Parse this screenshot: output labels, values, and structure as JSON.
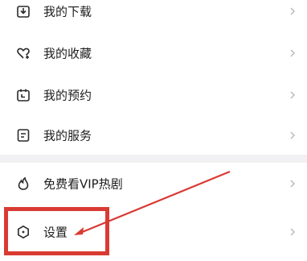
{
  "menu": {
    "items": [
      {
        "label": "我的下载",
        "icon": "download-icon"
      },
      {
        "label": "我的收藏",
        "icon": "favorite-heart-icon"
      },
      {
        "label": "我的预约",
        "icon": "calendar-icon"
      },
      {
        "label": "我的服务",
        "icon": "service-document-icon"
      },
      {
        "label": "免费看VIP热剧",
        "icon": "flame-icon"
      },
      {
        "label": "设置",
        "icon": "settings-icon"
      }
    ]
  },
  "annotation": {
    "highlight_color": "#d93a33",
    "highlight_target": "设置"
  },
  "colors": {
    "background": "#f1f1f3",
    "card": "#ffffff",
    "text": "#1d1d1f",
    "icon": "#2a2a2c",
    "chevron": "#b8b8bc"
  }
}
